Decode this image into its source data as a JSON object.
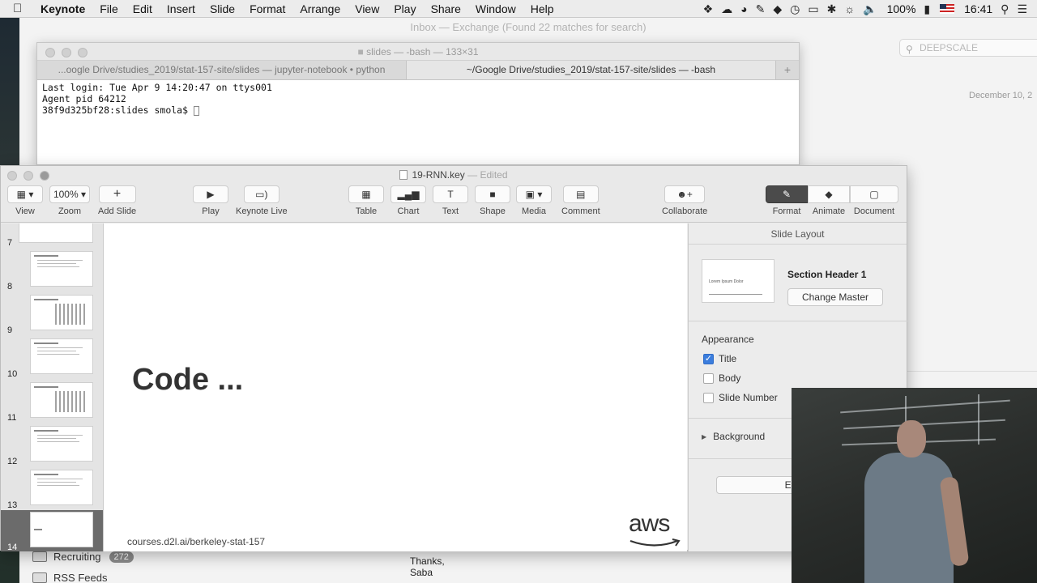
{
  "menubar": {
    "app_name": "Keynote",
    "items": [
      "File",
      "Edit",
      "Insert",
      "Slide",
      "Format",
      "Arrange",
      "View",
      "Play",
      "Share",
      "Window",
      "Help"
    ],
    "battery": "100%",
    "clock": "16:41"
  },
  "mail": {
    "title": "Inbox — Exchange (Found 22 matches for search)",
    "search_value": "DEEPSCALE",
    "date": "December 10, 2",
    "sidebar": [
      {
        "label": "Recruiting",
        "badge": "272"
      },
      {
        "label": "RSS Feeds",
        "badge": ""
      }
    ],
    "body_lines": [
      "Thanks,",
      "Saba"
    ]
  },
  "terminal": {
    "title": "slides — -bash — 133×31",
    "tabs": [
      {
        "label": "...oogle Drive/studies_2019/stat-157-site/slides — jupyter-notebook • python",
        "active": false
      },
      {
        "label": "~/Google Drive/studies_2019/stat-157-site/slides — -bash",
        "active": true
      }
    ],
    "lines": [
      "Last login: Tue Apr  9 14:20:47 on ttys001",
      "Agent pid 64212",
      "38f9d325bf28:slides smola$ "
    ]
  },
  "keynote": {
    "filename": "19-RNN.key",
    "status": "Edited",
    "toolbar": {
      "view": "View",
      "zoom": "Zoom",
      "zoom_value": "100%",
      "add_slide": "Add Slide",
      "play": "Play",
      "keynote_live": "Keynote Live",
      "table": "Table",
      "chart": "Chart",
      "text": "Text",
      "shape": "Shape",
      "media": "Media",
      "comment": "Comment",
      "collaborate": "Collaborate",
      "format": "Format",
      "animate": "Animate",
      "document": "Document"
    },
    "slides": [
      {
        "number": "7"
      },
      {
        "number": "8"
      },
      {
        "number": "9"
      },
      {
        "number": "10"
      },
      {
        "number": "11"
      },
      {
        "number": "12"
      },
      {
        "number": "13"
      },
      {
        "number": "14",
        "selected": true
      }
    ],
    "canvas": {
      "title": "Code ...",
      "footer": "courses.d2l.ai/berkeley-stat-157",
      "logo": "aws"
    },
    "inspector": {
      "header": "Slide Layout",
      "master_name": "Section Header 1",
      "layout_thumb_text": "Lorem Ipsum Dolor",
      "change_master": "Change Master",
      "appearance": "Appearance",
      "checks": [
        {
          "label": "Title",
          "checked": true
        },
        {
          "label": "Body",
          "checked": false
        },
        {
          "label": "Slide Number",
          "checked": false
        }
      ],
      "background": "Background",
      "edit_master": "Edit Ma"
    }
  }
}
